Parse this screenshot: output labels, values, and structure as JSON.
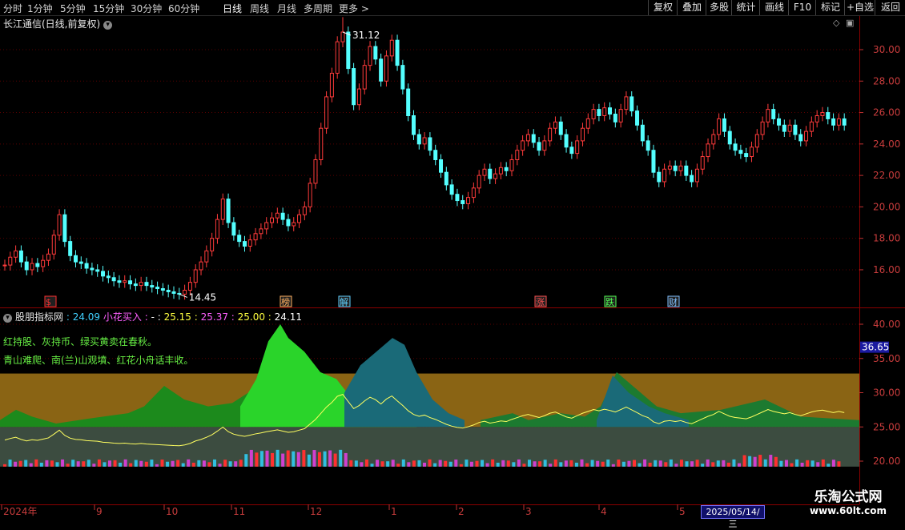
{
  "toolbar": {
    "periods": [
      "分时",
      "1分钟",
      "5分钟",
      "15分钟",
      "30分钟",
      "60分钟",
      "日线",
      "周线",
      "月线",
      "多周期",
      "更多 >"
    ],
    "active_period": "日线",
    "right_buttons": [
      "复权",
      "叠加",
      "多股",
      "统计",
      "画线",
      "F10",
      "标记",
      "+自选",
      "返回"
    ]
  },
  "main_chart": {
    "stock_title": "长江通信(日线,前复权)",
    "high_label": "31.12",
    "low_label": "14.45",
    "price_axis": [
      "30.00",
      "28.00",
      "26.00",
      "24.00",
      "22.00",
      "20.00",
      "18.00",
      "16.00"
    ],
    "event_markers": [
      {
        "text": "$",
        "color": "#ff3030"
      },
      {
        "text": "榜",
        "color": "#ffb060"
      },
      {
        "text": "解",
        "color": "#60d0ff"
      },
      {
        "text": "涨",
        "color": "#ff5050"
      },
      {
        "text": "跌",
        "color": "#50ff50"
      },
      {
        "text": "财",
        "color": "#80c0ff"
      }
    ]
  },
  "indicator": {
    "name": "股朋指标网",
    "values": [
      {
        "text": ": 24.09",
        "color": "#40d0ff"
      },
      {
        "text": "小花买入 :",
        "color": "#ff60ff"
      },
      {
        "text": "- :",
        "color": "#ffffff"
      },
      {
        "text": "25.15 :",
        "color": "#ffff40"
      },
      {
        "text": "25.37 :",
        "color": "#ff60ff"
      },
      {
        "text": "25.00 :",
        "color": "#ffff40"
      },
      {
        "text": "24.11",
        "color": "#ffffff"
      }
    ],
    "note1": "红持股、灰持币、绿买黄卖在春秋。",
    "note2": "青山难爬、南(兰)山观墳、红花小舟话丰收。",
    "axis": [
      "40.00",
      "35.00",
      "30.00",
      "25.00",
      "20.00"
    ],
    "current_value": "36.65"
  },
  "time_axis": {
    "labels": [
      "2024年",
      "9",
      "10",
      "11",
      "12",
      "1",
      "2",
      "3",
      "4",
      "5"
    ],
    "cursor_date": "2025/05/14/三"
  },
  "watermark": {
    "line1": "乐淘公式网",
    "line2": "www.60lt.com"
  },
  "chart_data": {
    "type": "candlestick",
    "price_range": [
      14.45,
      31.12
    ],
    "indicator_range": [
      18,
      41
    ],
    "close_series": [
      16.3,
      16.8,
      17.2,
      16.5,
      16.0,
      16.4,
      16.2,
      16.6,
      17.0,
      18.2,
      19.5,
      17.8,
      16.9,
      16.5,
      16.4,
      16.1,
      16.0,
      15.9,
      15.6,
      15.5,
      15.3,
      15.2,
      15.3,
      15.1,
      15.0,
      15.2,
      15.0,
      14.9,
      14.8,
      14.7,
      14.6,
      14.5,
      14.45,
      14.7,
      15.2,
      16.0,
      16.5,
      17.2,
      18.0,
      19.2,
      20.5,
      19.0,
      18.2,
      17.8,
      17.5,
      17.9,
      18.3,
      18.6,
      19.0,
      19.3,
      19.6,
      19.2,
      18.8,
      19.0,
      19.5,
      20.0,
      21.5,
      23.0,
      25.0,
      27.0,
      28.5,
      30.5,
      31.12,
      28.8,
      26.5,
      27.5,
      29.0,
      30.2,
      29.4,
      28.0,
      29.6,
      30.6,
      29.0,
      27.5,
      25.8,
      24.6,
      24.0,
      24.4,
      23.6,
      23.0,
      22.2,
      21.4,
      20.8,
      20.4,
      20.2,
      20.6,
      21.2,
      22.0,
      22.4,
      21.8,
      22.1,
      22.5,
      22.3,
      23.0,
      23.6,
      24.2,
      24.6,
      24.1,
      23.6,
      24.2,
      25.0,
      25.4,
      24.6,
      23.8,
      23.4,
      24.2,
      25.0,
      25.6,
      26.2,
      25.8,
      26.3,
      25.9,
      25.4,
      26.2,
      27.0,
      26.1,
      25.2,
      24.2,
      23.6,
      22.2,
      21.6,
      22.4,
      22.6,
      22.3,
      22.6,
      22.0,
      21.6,
      22.4,
      23.2,
      24.0,
      24.6,
      25.6,
      24.8,
      24.0,
      23.6,
      23.4,
      23.2,
      23.8,
      24.6,
      25.4,
      26.2,
      25.6,
      25.2,
      24.8,
      25.2,
      24.6,
      24.2,
      24.8,
      25.4,
      25.8,
      26.0,
      25.6,
      25.2,
      25.6,
      25.2
    ]
  }
}
